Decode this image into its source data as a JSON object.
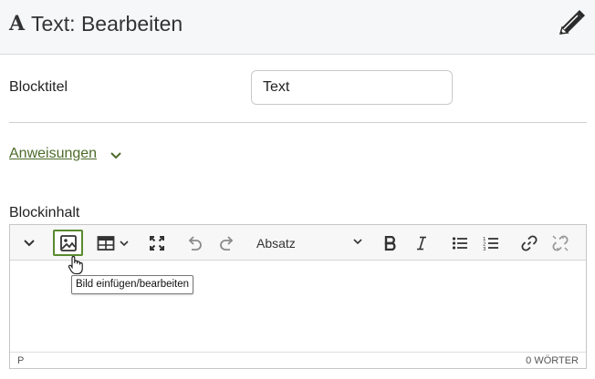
{
  "header": {
    "title": "Text: Bearbeiten",
    "title_icon": "A",
    "edit_icon": "pencil-icon"
  },
  "block_title": {
    "label": "Blocktitel",
    "value": "Text"
  },
  "instructions": {
    "label": "Anweisungen"
  },
  "block_content": {
    "label": "Blockinhalt"
  },
  "editor": {
    "toolbar": {
      "collapse_icon": "chevron-down-icon",
      "image_icon": "image-icon",
      "table_icon": "table-icon",
      "fullscreen_icon": "fullscreen-icon",
      "undo_icon": "undo-icon",
      "redo_icon": "redo-icon",
      "format_value": "Absatz",
      "bold_icon": "bold-icon",
      "italic_icon": "italic-icon",
      "bullet_list_icon": "bullet-list-icon",
      "numbered_list_icon": "numbered-list-icon",
      "link_icon": "link-icon",
      "unlink_icon": "unlink-icon"
    },
    "status_path": "P",
    "word_count": "0 WÖRTER",
    "tooltip": "Bild einfügen/bearbeiten"
  },
  "colors": {
    "accent_green": "#5a8a2e",
    "link_green": "#4c6b2a",
    "header_bg": "#f6f7f9"
  }
}
